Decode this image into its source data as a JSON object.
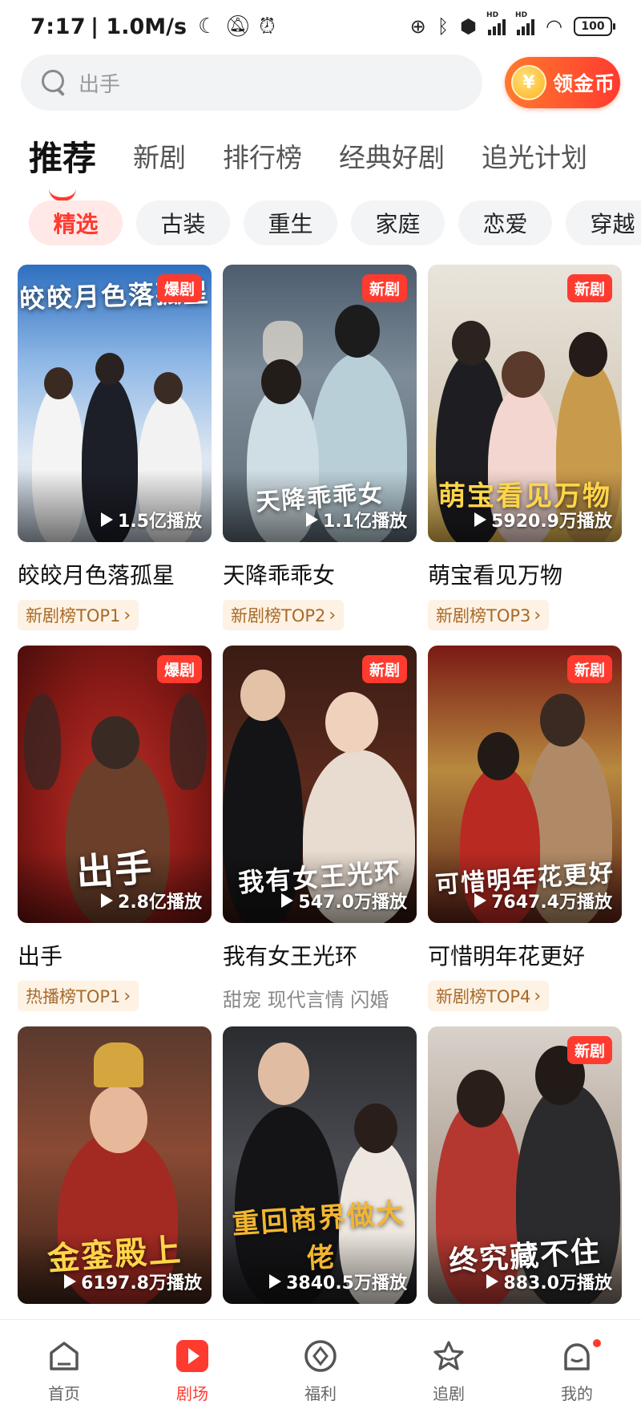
{
  "status_bar": {
    "time": "7:17",
    "net_speed": "| 1.0M/s",
    "battery": "100"
  },
  "search": {
    "placeholder": "出手",
    "coin_button": "领金币",
    "coin_symbol": "¥"
  },
  "main_tabs": [
    "推荐",
    "新剧",
    "排行榜",
    "经典好剧",
    "追光计划"
  ],
  "chips": [
    "精选",
    "古装",
    "重生",
    "家庭",
    "恋爱",
    "穿越"
  ],
  "dramas": [
    {
      "title": "皎皎月色落孤星",
      "badge": "爆剧",
      "plays": "1.5亿播放",
      "poster_text": "皎皎月色落孤星",
      "rank": "新剧榜TOP1",
      "tags": ""
    },
    {
      "title": "天降乖乖女",
      "badge": "新剧",
      "plays": "1.1亿播放",
      "poster_text": "天降乖乖女",
      "rank": "新剧榜TOP2",
      "tags": ""
    },
    {
      "title": "萌宝看见万物",
      "badge": "新剧",
      "plays": "5920.9万播放",
      "poster_text": "萌宝看见万物",
      "rank": "新剧榜TOP3",
      "tags": ""
    },
    {
      "title": "出手",
      "badge": "爆剧",
      "plays": "2.8亿播放",
      "poster_text": "出手",
      "rank": "热播榜TOP1",
      "tags": ""
    },
    {
      "title": "我有女王光环",
      "badge": "新剧",
      "plays": "547.0万播放",
      "poster_text": "我有女王光环",
      "rank": "",
      "tags": "甜宠 现代言情 闪婚"
    },
    {
      "title": "可惜明年花更好",
      "badge": "新剧",
      "plays": "7647.4万播放",
      "poster_text": "可惜明年花更好",
      "rank": "新剧榜TOP4",
      "tags": ""
    },
    {
      "title": "",
      "badge": "",
      "plays": "6197.8万播放",
      "poster_text": "金銮殿上",
      "rank": "",
      "tags": ""
    },
    {
      "title": "",
      "badge": "",
      "plays": "3840.5万播放",
      "poster_text": "重回商界做大佬",
      "rank": "",
      "tags": ""
    },
    {
      "title": "",
      "badge": "新剧",
      "plays": "883.0万播放",
      "poster_text": "终究藏不住",
      "rank": "",
      "tags": ""
    }
  ],
  "bottom_nav": [
    {
      "label": "首页",
      "icon": "home-icon"
    },
    {
      "label": "剧场",
      "icon": "theater-play-icon"
    },
    {
      "label": "福利",
      "icon": "welfare-icon"
    },
    {
      "label": "追剧",
      "icon": "star-follow-icon"
    },
    {
      "label": "我的",
      "icon": "profile-icon"
    }
  ],
  "colors": {
    "accent": "#ff3a2f",
    "rank_tag_bg": "#fdf2e4",
    "rank_tag_text": "#a86a2a"
  }
}
